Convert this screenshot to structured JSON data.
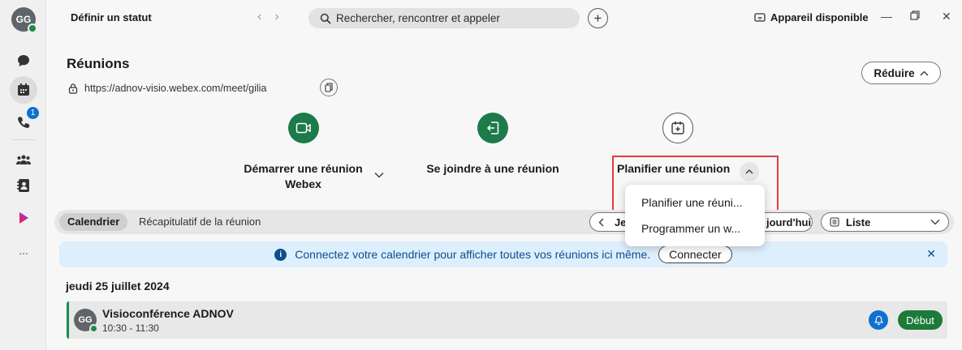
{
  "rail": {
    "avatar_initials": "GG",
    "call_badge_count": "1",
    "more_label": "..."
  },
  "topbar": {
    "status_label": "Définir un statut",
    "search_placeholder": "Rechercher, rencontrer et appeler",
    "device_label": "Appareil disponible"
  },
  "page": {
    "title": "Réunions",
    "meeting_url": "https://adnov-visio.webex.com/meet/gilia",
    "reduce_label": "Réduire"
  },
  "actions": {
    "start_label_line1": "Démarrer une réunion",
    "start_label_line2": "Webex",
    "join_label": "Se joindre à une réunion",
    "schedule_label": "Planifier une réunion"
  },
  "tabs": {
    "calendar": "Calendrier",
    "recap": "Récapitulatif de la réunion",
    "today_fragment_left": "Je",
    "today_fragment_right": "jourd'hui",
    "view_label": "Liste"
  },
  "menu": {
    "items": [
      "Planifier une réuni...",
      "Programmer un w..."
    ]
  },
  "banner": {
    "text": "Connectez votre calendrier pour afficher toutes vos réunions ici même.",
    "connect_label": "Connecter"
  },
  "agenda": {
    "date": "jeudi 25 juillet 2024",
    "meeting_title": "Visioconférence ADNOV",
    "meeting_time": "10:30 - 11:30",
    "meeting_avatar": "GG",
    "start_label": "Début"
  },
  "colors": {
    "accent_green": "#1d7a4a",
    "highlight_red": "#e53b3b",
    "banner_blue": "#ddeefc",
    "badge_blue": "#1170cf"
  }
}
